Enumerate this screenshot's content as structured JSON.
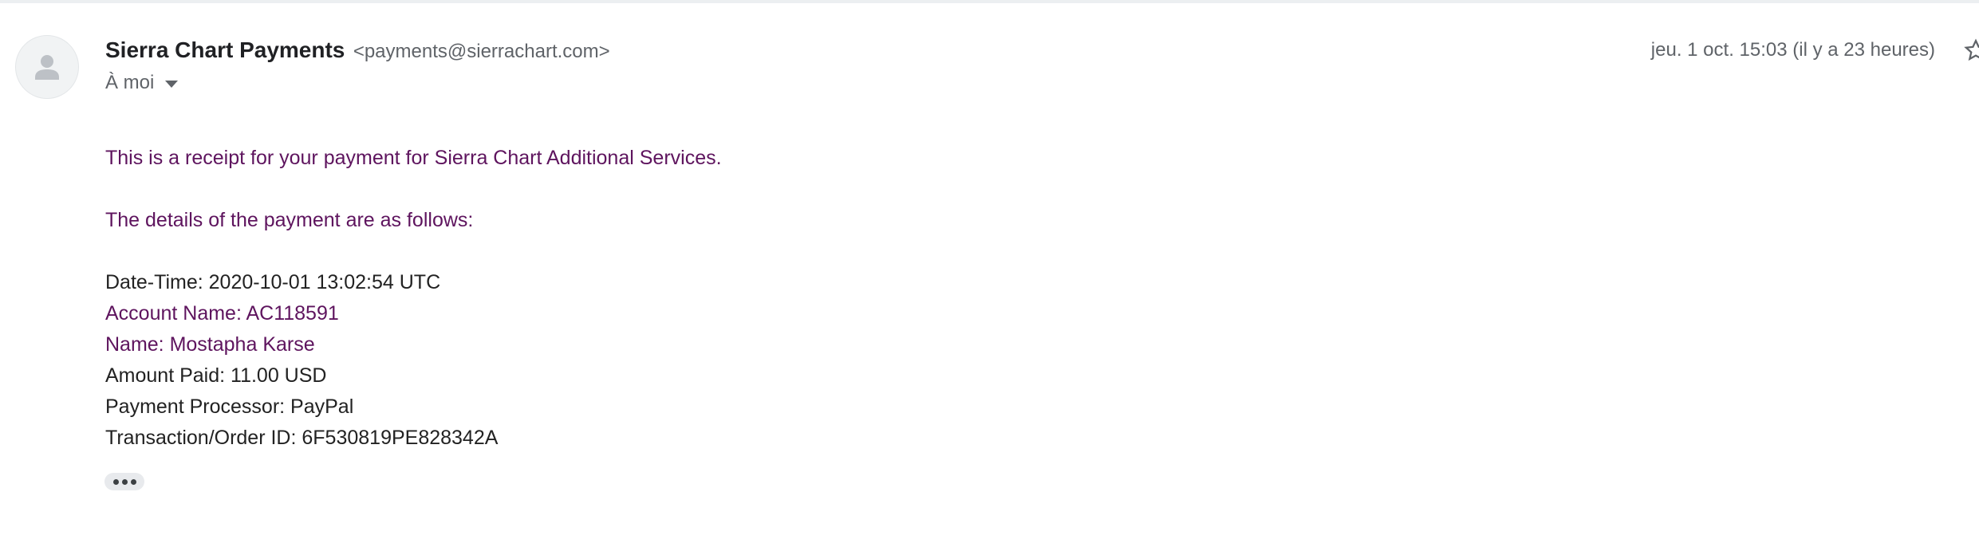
{
  "header": {
    "sender_name": "Sierra Chart Payments",
    "sender_email": "<payments@sierrachart.com>",
    "recipient": "À moi",
    "date": "jeu. 1 oct. 15:03 (il y a 23 heures)"
  },
  "body": {
    "intro": "This is a receipt for your payment for Sierra Chart Additional Services.",
    "details_heading": "The details of the payment are as follows:",
    "date_time": "Date-Time:  2020-10-01 13:02:54 UTC",
    "account_name": "Account Name: AC118591",
    "name": "Name: Mostapha Karse",
    "amount_paid": "Amount Paid: 11.00 USD",
    "payment_processor": "Payment Processor: PayPal",
    "transaction_id": "Transaction/Order ID: 6F530819PE828342A"
  },
  "icons": {
    "avatar": "person-icon",
    "dropdown": "caret-down-icon",
    "star": "star-icon",
    "more": "ellipsis-icon"
  },
  "colors": {
    "link_purple": "#5e145e",
    "text_dark": "#222222",
    "meta_gray": "#5f6368"
  }
}
